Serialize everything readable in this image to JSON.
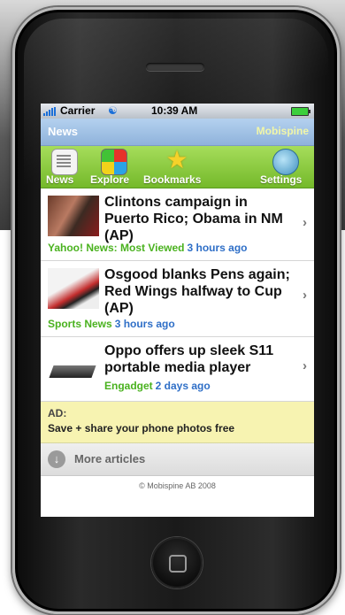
{
  "status_bar": {
    "carrier": "Carrier",
    "time": "10:39 AM",
    "wifi_icon": "wifi-icon",
    "battery_icon": "battery-icon"
  },
  "title_bar": {
    "title": "News",
    "brand": "Mobispine"
  },
  "tabs": [
    {
      "label": "News",
      "icon": "newspaper-icon"
    },
    {
      "label": "Explore",
      "icon": "explore-cube-icon"
    },
    {
      "label": "Bookmarks",
      "icon": "star-icon"
    },
    {
      "label": "Settings",
      "icon": "globe-settings-icon"
    }
  ],
  "articles": [
    {
      "headline": "Clintons campaign in Puerto Rico; Obama in NM (AP)",
      "source": "Yahoo! News: Most Viewed",
      "time": "3 hours ago"
    },
    {
      "headline": "Osgood blanks Pens again; Red Wings halfway to Cup (AP)",
      "source": "Sports News",
      "time": "3 hours ago"
    },
    {
      "headline": "Oppo offers up sleek S11 portable media player",
      "source": "Engadget",
      "time": "2 days ago"
    }
  ],
  "ad": {
    "label": "AD:",
    "text": "Save + share your phone photos free"
  },
  "more": {
    "label": "More articles"
  },
  "footer": {
    "copyright": "© Mobispine AB 2008"
  },
  "colors": {
    "tab_bar_green": "#74b92a",
    "title_bar_blue": "#8fb2db",
    "source_green": "#4ab21f",
    "time_blue": "#2f6fc7",
    "ad_yellow": "#f7f3b1"
  }
}
